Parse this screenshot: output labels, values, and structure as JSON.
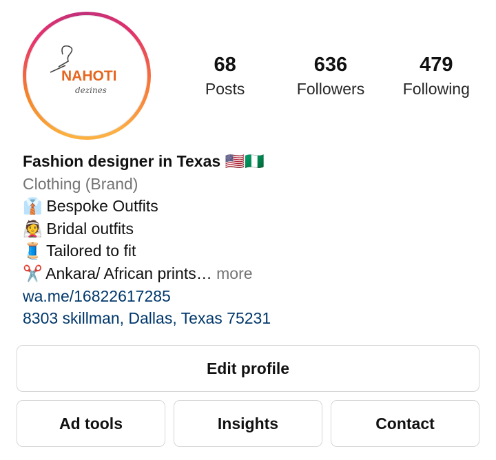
{
  "profile": {
    "logo_text_main": "NAHOTI",
    "logo_text_sub": "dezines"
  },
  "stats": [
    {
      "value": "68",
      "label": "Posts"
    },
    {
      "value": "636",
      "label": "Followers"
    },
    {
      "value": "479",
      "label": "Following"
    }
  ],
  "bio": {
    "name": "Fashion designer in Texas 🇺🇸🇳🇬",
    "category": "Clothing (Brand)",
    "lines": [
      {
        "emoji": "👔",
        "text": "Bespoke Outfits"
      },
      {
        "emoji": "👰",
        "text": "Bridal outfits"
      },
      {
        "emoji": "🧵",
        "text": "Tailored to fit"
      },
      {
        "emoji": "✂️",
        "text": "Ankara/ African prints…",
        "more": " more"
      }
    ],
    "link": "wa.me/16822617285",
    "address": "8303 skillman, Dallas, Texas 75231"
  },
  "buttons": {
    "edit_profile": "Edit profile",
    "ad_tools": "Ad tools",
    "insights": "Insights",
    "contact": "Contact"
  },
  "colors": {
    "link": "#00376b",
    "secondary_text": "#737373",
    "button_border": "#d6d6d6",
    "logo_orange": "#e5661f"
  }
}
